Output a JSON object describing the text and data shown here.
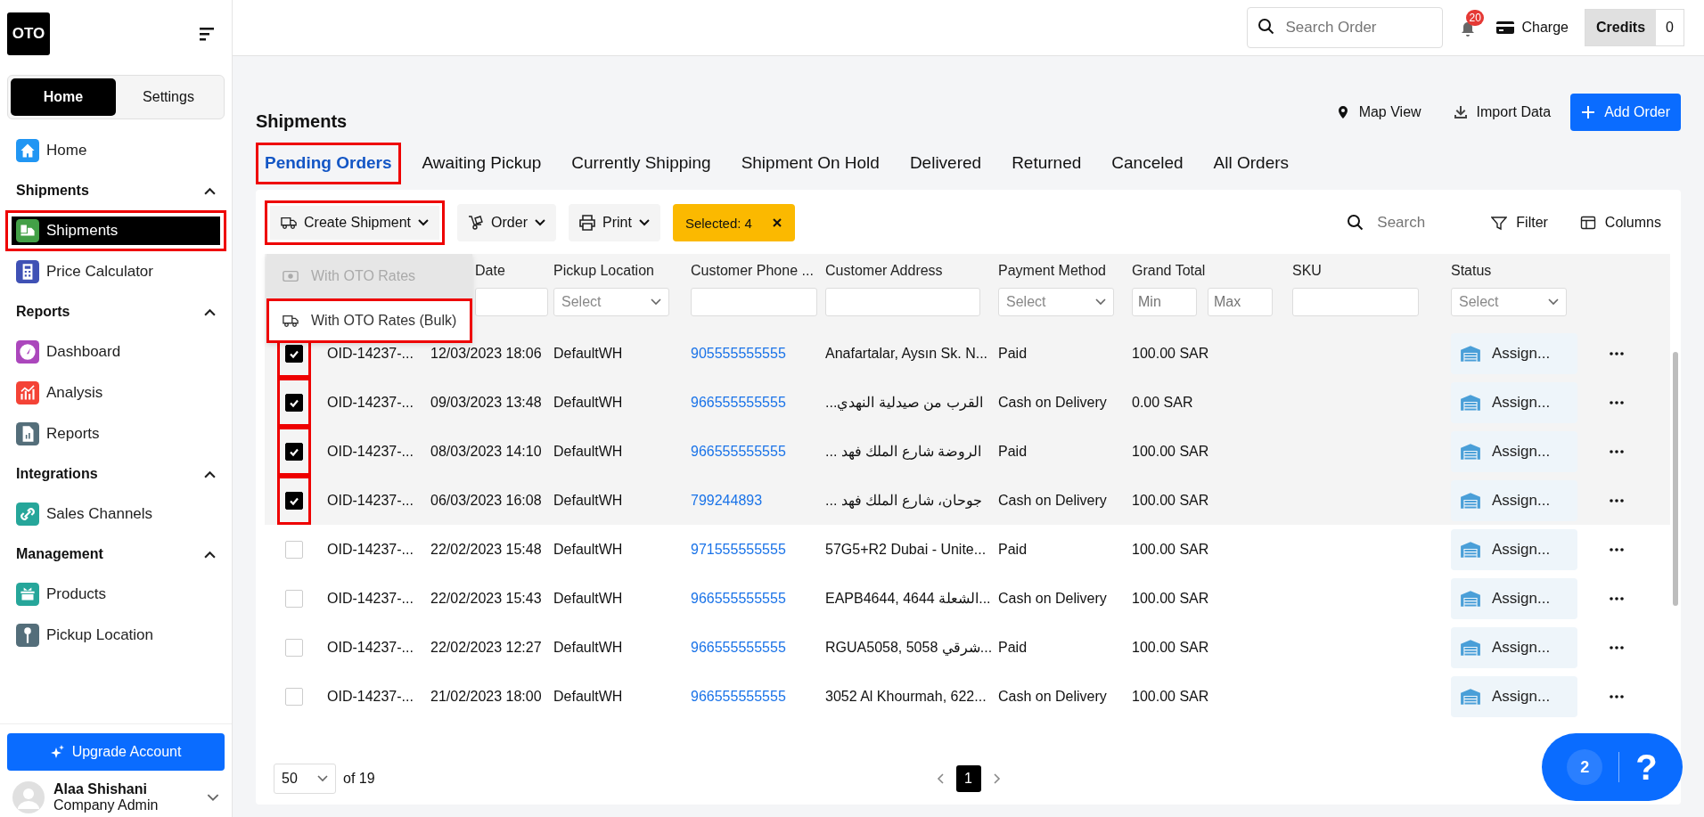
{
  "sidebar": {
    "logo": "OTO",
    "segments": [
      {
        "label": "Home",
        "selected": true
      },
      {
        "label": "Settings",
        "selected": false
      }
    ],
    "nav": [
      {
        "kind": "item",
        "label": "Home",
        "color": "#2196f3",
        "selected": false,
        "highlighted": false
      },
      {
        "kind": "section",
        "label": "Shipments",
        "expanded": true
      },
      {
        "kind": "item",
        "label": "Shipments",
        "color": "#43a047",
        "selected": true,
        "highlighted": true
      },
      {
        "kind": "item",
        "label": "Price Calculator",
        "color": "#3f51b5",
        "selected": false,
        "highlighted": false
      },
      {
        "kind": "section",
        "label": "Reports",
        "expanded": true
      },
      {
        "kind": "item",
        "label": "Dashboard",
        "color": "#ab47bc",
        "selected": false,
        "highlighted": false
      },
      {
        "kind": "item",
        "label": "Analysis",
        "color": "#f44336",
        "selected": false,
        "highlighted": false
      },
      {
        "kind": "item",
        "label": "Reports",
        "color": "#546e7a",
        "selected": false,
        "highlighted": false
      },
      {
        "kind": "section",
        "label": "Integrations",
        "expanded": true
      },
      {
        "kind": "item",
        "label": "Sales Channels",
        "color": "#26a69a",
        "selected": false,
        "highlighted": false
      },
      {
        "kind": "section",
        "label": "Management",
        "expanded": true
      },
      {
        "kind": "item",
        "label": "Products",
        "color": "#26a69a",
        "selected": false,
        "highlighted": false
      },
      {
        "kind": "item",
        "label": "Pickup Location",
        "color": "#546e7a",
        "selected": false,
        "highlighted": false
      }
    ],
    "upgrade_button": "Upgrade Account",
    "user": {
      "name": "Alaa Shishani",
      "role": "Company Admin"
    }
  },
  "topbar": {
    "search": {
      "placeholder": "Search Order"
    },
    "notifications": "20",
    "charge": "Charge",
    "credits": {
      "label": "Credits",
      "value": "0"
    }
  },
  "page": {
    "title": "Shipments",
    "actions": [
      "Map View",
      "Import Data"
    ],
    "primary_action": "Add Order"
  },
  "tabs": [
    {
      "label": "Pending Orders",
      "selected": true,
      "highlighted": true
    },
    {
      "label": "Awaiting Pickup",
      "selected": false,
      "highlighted": false
    },
    {
      "label": "Currently Shipping",
      "selected": false,
      "highlighted": false
    },
    {
      "label": "Shipment On Hold",
      "selected": false,
      "highlighted": false
    },
    {
      "label": "Delivered",
      "selected": false,
      "highlighted": false
    },
    {
      "label": "Returned",
      "selected": false,
      "highlighted": false
    },
    {
      "label": "Canceled",
      "selected": false,
      "highlighted": false
    },
    {
      "label": "All Orders",
      "selected": false,
      "highlighted": false
    }
  ],
  "toolbar": {
    "create_shipment": {
      "label": "Create Shipment",
      "highlighted": true
    },
    "order": "Order",
    "print": "Print",
    "selected_badge": "Selected: 4",
    "search": {
      "placeholder": "Search"
    },
    "filter": "Filter",
    "columns": "Columns"
  },
  "menu": [
    {
      "label": "With OTO Rates",
      "disabled": true,
      "highlighted": false
    },
    {
      "label": "With OTO Rates (Bulk)",
      "disabled": false,
      "highlighted": true
    }
  ],
  "table": {
    "columns": [
      {
        "label": "Date"
      },
      {
        "label": "Pickup Location",
        "placeholder": "Select"
      },
      {
        "label": "Customer Phone ..."
      },
      {
        "label": "Customer Address"
      },
      {
        "label": "Payment Method",
        "placeholder": "Select"
      },
      {
        "label": "Grand Total",
        "fields": [
          {
            "placeholder": "Min"
          },
          {
            "placeholder": "Max"
          }
        ]
      },
      {
        "label": "SKU"
      },
      {
        "label": "Status",
        "placeholder": "Select"
      }
    ],
    "rows": [
      {
        "selected": true,
        "id": "OID-14237-...",
        "date": "12/03/2023 18:06",
        "location": "DefaultWH",
        "phone": "905555555555",
        "address": "Anafartalar, Aysın Sk. N...",
        "payment": "Paid",
        "total": "100.00 SAR",
        "status": "Assign..."
      },
      {
        "selected": true,
        "id": "OID-14237-...",
        "date": "09/03/2023 13:48",
        "location": "DefaultWH",
        "phone": "966555555555",
        "address": "القرب من صيدلية النهدي...",
        "payment": "Cash on Delivery",
        "total": "0.00 SAR",
        "status": "Assign..."
      },
      {
        "selected": true,
        "id": "OID-14237-...",
        "date": "08/03/2023 14:10",
        "location": "DefaultWH",
        "phone": "966555555555",
        "address": "الروضة شارع الملك فهد ...",
        "payment": "Paid",
        "total": "100.00 SAR",
        "status": "Assign..."
      },
      {
        "selected": true,
        "id": "OID-14237-...",
        "date": "06/03/2023 16:08",
        "location": "DefaultWH",
        "phone": "799244893",
        "address": "جوحان، شارع الملك فهد ...",
        "payment": "Cash on Delivery",
        "total": "100.00 SAR",
        "status": "Assign..."
      },
      {
        "selected": false,
        "id": "OID-14237-...",
        "date": "22/02/2023 15:48",
        "location": "DefaultWH",
        "phone": "971555555555",
        "address": "57G5+R2 Dubai - Unite...",
        "payment": "Paid",
        "total": "100.00 SAR",
        "status": "Assign..."
      },
      {
        "selected": false,
        "id": "OID-14237-...",
        "date": "22/02/2023 15:43",
        "location": "DefaultWH",
        "phone": "966555555555",
        "address": "EAPB4644, 4644 الشعلة...",
        "payment": "Cash on Delivery",
        "total": "100.00 SAR",
        "status": "Assign..."
      },
      {
        "selected": false,
        "id": "OID-14237-...",
        "date": "22/02/2023 12:27",
        "location": "DefaultWH",
        "phone": "966555555555",
        "address": "RGUA5058, 5058 شرقي...",
        "payment": "Paid",
        "total": "100.00 SAR",
        "status": "Assign..."
      },
      {
        "selected": false,
        "id": "OID-14237-...",
        "date": "21/02/2023 18:00",
        "location": "DefaultWH",
        "phone": "966555555555",
        "address": "3052 Al Khourmah, 622...",
        "payment": "Cash on Delivery",
        "total": "100.00 SAR",
        "status": "Assign..."
      }
    ]
  },
  "pagination": {
    "page_size": "50",
    "of": "of 19",
    "pages": [
      {
        "label": "1",
        "selected": true
      }
    ]
  },
  "help_widget": {
    "count": "2",
    "label": "?"
  }
}
